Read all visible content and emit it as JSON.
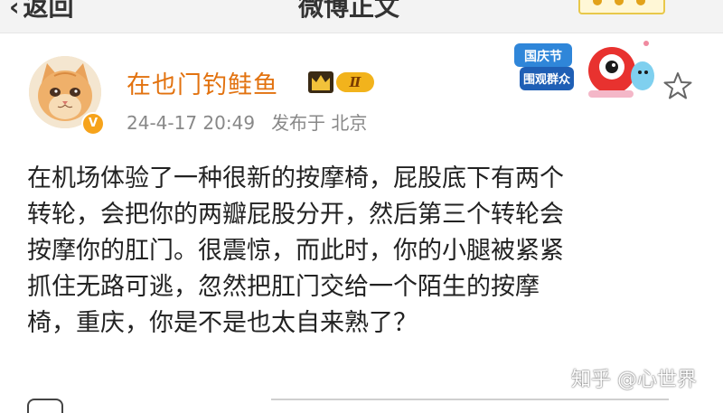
{
  "top_bar": {
    "back_label": "返回",
    "title": "微博正文"
  },
  "author": {
    "name": "在也门钓鲑鱼",
    "verified_mark": "V",
    "level": "Ⅱ",
    "crown_icon": "crown-icon"
  },
  "post_meta": {
    "time": "24-4-17 20:49",
    "location": "发布于 北京"
  },
  "post": {
    "lines": [
      "在机场体验了一种很新的按摩椅，屁股底下有两个",
      "转轮，会把你的两瓣屁股分开，然后第三个转轮会",
      "按摩你的肛门。很震惊，而此时，你的小腿被紧紧",
      "抓住无路可逃，忽然把肛门交给一个陌生的按摩",
      "椅，重庆，你是不是也太自来熟了？"
    ]
  },
  "event_badge": {
    "line1": "国庆节",
    "line2": "围观群众"
  },
  "watermark": "知乎 @心世界",
  "colors": {
    "username": "#e2720f",
    "meta": "#888888",
    "level_badge": "#f2b31c",
    "verified_badge": "#f6a31b"
  }
}
